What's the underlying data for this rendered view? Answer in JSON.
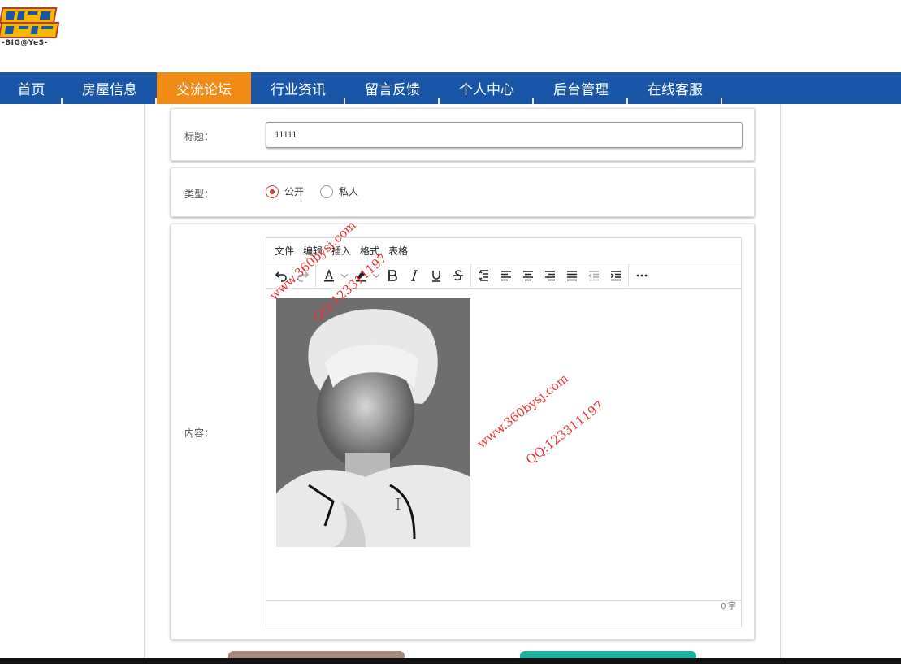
{
  "logo": {
    "caption": "-BIG@YeS-"
  },
  "nav": {
    "items": [
      {
        "label": "首页",
        "active": false
      },
      {
        "label": "房屋信息",
        "active": false
      },
      {
        "label": "交流论坛",
        "active": true
      },
      {
        "label": "行业资讯",
        "active": false
      },
      {
        "label": "留言反馈",
        "active": false
      },
      {
        "label": "个人中心",
        "active": false
      },
      {
        "label": "后台管理",
        "active": false
      },
      {
        "label": "在线客服",
        "active": false
      }
    ]
  },
  "form": {
    "title_label": "标题：",
    "title_value": "11111",
    "type_label": "类型：",
    "type_options": [
      {
        "label": "公开",
        "checked": true
      },
      {
        "label": "私人",
        "checked": false
      }
    ],
    "content_label": "内容："
  },
  "editor": {
    "menu": [
      "文件",
      "编辑",
      "插入",
      "格式",
      "表格"
    ],
    "word_count": "0 字"
  },
  "watermark": {
    "site": "www.360bysj.com",
    "qq": "QQ:123311197"
  },
  "colors": {
    "nav_bg": "#1a56a8",
    "nav_active": "#f28a16",
    "radio_accent": "#d23b2a",
    "save_button": "#a88a7e",
    "reset_button": "#19b3a0"
  }
}
